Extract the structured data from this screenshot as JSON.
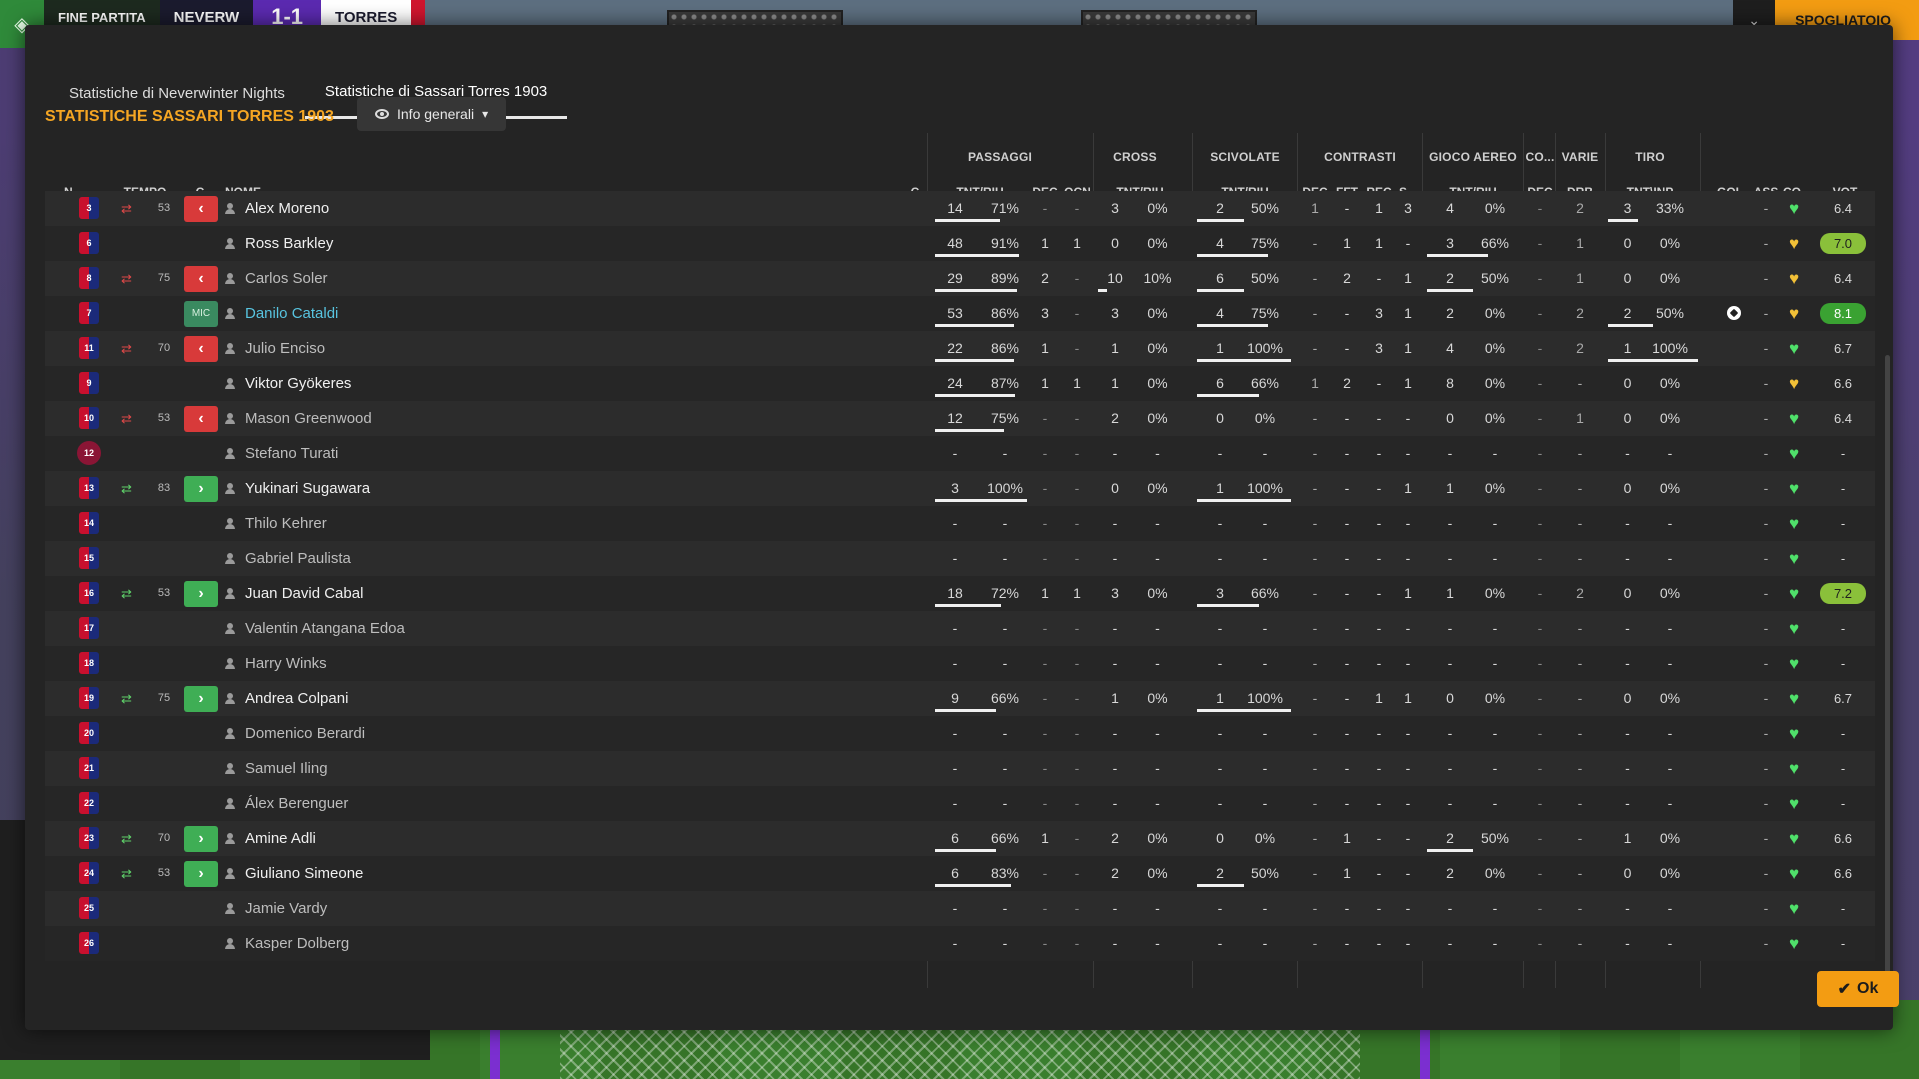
{
  "scorebar": {
    "status": "FINE PARTITA",
    "home": "NEVERW",
    "score": "1-1",
    "away": "TORRES"
  },
  "topright": {
    "collapse_icon": "chevron-down-icon",
    "dressing_room": "SPOGLIATOIO"
  },
  "tabs": [
    {
      "label": "Statistiche di Neverwinter Nights",
      "active": false
    },
    {
      "label": "Statistiche di Sassari Torres 1903",
      "active": true
    }
  ],
  "section_title": "STATISTICHE SASSARI TORRES 1903",
  "view_select": {
    "label": "Info generali"
  },
  "groups": {
    "passaggi": "PASSAGGI",
    "cross": "CROSS",
    "scivolate": "SCIVOLATE",
    "contrasti": "CONTRASTI",
    "gioco_aereo": "GIOCO AEREO",
    "co": "CO...",
    "varie": "VARIE",
    "tiro": "TIRO"
  },
  "headers": {
    "n": "N.",
    "tempo": "TEMPO",
    "c": "C",
    "nome": "NOME",
    "c2": "C",
    "pass_tnt": "TNT/RIU",
    "pass_dec": "DEC",
    "pass_ocn": "OCN",
    "cross_tnt": "TNT/RIU",
    "sciv_tnt": "TNT/RIU",
    "con_dec": "DEC",
    "con_fft": "FFT",
    "con_rec": "REC",
    "con_s": "S...",
    "aereo_tnt": "TNT/RIU",
    "co_dec": "DEC",
    "varie_drb": "DRB",
    "tiro_tnt": "TNT\\INP",
    "gol": "GOL",
    "ass": "ASS",
    "co2": "CO...",
    "vot": "VOT"
  },
  "players": [
    {
      "n": "3",
      "sub": "out",
      "min": "53",
      "c": "out",
      "name": "Alex Moreno",
      "played": true,
      "pass": [
        "14",
        "71%"
      ],
      "pass_bar": 0.71,
      "dec": "-",
      "ocn": "-",
      "cross": [
        "3",
        "0%"
      ],
      "cross_bar": 0,
      "sciv": [
        "2",
        "50%"
      ],
      "sciv_bar": 0.5,
      "con": [
        "1",
        "-",
        "1",
        "3"
      ],
      "aereo": [
        "4",
        "0%"
      ],
      "aereo_bar": 0,
      "codec": "-",
      "drb": "2",
      "tiro": [
        "3",
        "33%"
      ],
      "tiro_bar": 0.33,
      "gol": "",
      "ass": "-",
      "heart": "green",
      "vot": "6.4",
      "vclass": ""
    },
    {
      "n": "6",
      "sub": "",
      "min": "",
      "c": "",
      "name": "Ross Barkley",
      "played": true,
      "pass": [
        "48",
        "91%"
      ],
      "pass_bar": 0.91,
      "dec": "1",
      "ocn": "1",
      "cross": [
        "0",
        "0%"
      ],
      "cross_bar": 0,
      "sciv": [
        "4",
        "75%"
      ],
      "sciv_bar": 0.75,
      "con": [
        "-",
        "1",
        "1",
        "-"
      ],
      "aereo": [
        "3",
        "66%"
      ],
      "aereo_bar": 0.66,
      "codec": "-",
      "drb": "1",
      "tiro": [
        "0",
        "0%"
      ],
      "tiro_bar": 0,
      "gol": "",
      "ass": "-",
      "heart": "yellow",
      "vot": "7.0",
      "vclass": "mid"
    },
    {
      "n": "8",
      "sub": "out",
      "min": "75",
      "c": "out",
      "name": "Carlos Soler",
      "played": false,
      "pass": [
        "29",
        "89%"
      ],
      "pass_bar": 0.89,
      "dec": "2",
      "ocn": "-",
      "cross": [
        "10",
        "10%"
      ],
      "cross_bar": 0.1,
      "sciv": [
        "6",
        "50%"
      ],
      "sciv_bar": 0.5,
      "con": [
        "-",
        "2",
        "-",
        "1"
      ],
      "aereo": [
        "2",
        "50%"
      ],
      "aereo_bar": 0.5,
      "codec": "-",
      "drb": "1",
      "tiro": [
        "0",
        "0%"
      ],
      "tiro_bar": 0,
      "gol": "",
      "ass": "-",
      "heart": "yellow",
      "vot": "6.4",
      "vclass": ""
    },
    {
      "n": "7",
      "sub": "",
      "min": "",
      "c": "pos",
      "cpos": "MIC",
      "name": "Danilo Cataldi",
      "played": true,
      "highlight": true,
      "pass": [
        "53",
        "86%"
      ],
      "pass_bar": 0.86,
      "dec": "3",
      "ocn": "-",
      "cross": [
        "3",
        "0%"
      ],
      "cross_bar": 0,
      "sciv": [
        "4",
        "75%"
      ],
      "sciv_bar": 0.75,
      "con": [
        "-",
        "-",
        "3",
        "1"
      ],
      "aereo": [
        "2",
        "0%"
      ],
      "aereo_bar": 0,
      "codec": "-",
      "drb": "2",
      "tiro": [
        "2",
        "50%"
      ],
      "tiro_bar": 0.5,
      "gol": "ball",
      "ass": "-",
      "heart": "yellow",
      "vot": "8.1",
      "vclass": "good"
    },
    {
      "n": "11",
      "sub": "out",
      "min": "70",
      "c": "out",
      "name": "Julio Enciso",
      "played": false,
      "pass": [
        "22",
        "86%"
      ],
      "pass_bar": 0.86,
      "dec": "1",
      "ocn": "-",
      "cross": [
        "1",
        "0%"
      ],
      "cross_bar": 0,
      "sciv": [
        "1",
        "100%"
      ],
      "sciv_bar": 1,
      "con": [
        "-",
        "-",
        "3",
        "1"
      ],
      "aereo": [
        "4",
        "0%"
      ],
      "aereo_bar": 0,
      "codec": "-",
      "drb": "2",
      "tiro": [
        "1",
        "100%"
      ],
      "tiro_bar": 1,
      "gol": "",
      "ass": "-",
      "heart": "green",
      "vot": "6.7",
      "vclass": ""
    },
    {
      "n": "9",
      "sub": "",
      "min": "",
      "c": "",
      "name": "Viktor Gyökeres",
      "played": true,
      "pass": [
        "24",
        "87%"
      ],
      "pass_bar": 0.87,
      "dec": "1",
      "ocn": "1",
      "cross": [
        "1",
        "0%"
      ],
      "cross_bar": 0,
      "sciv": [
        "6",
        "66%"
      ],
      "sciv_bar": 0.66,
      "con": [
        "1",
        "2",
        "-",
        "1"
      ],
      "aereo": [
        "8",
        "0%"
      ],
      "aereo_bar": 0,
      "codec": "-",
      "drb": "-",
      "tiro": [
        "0",
        "0%"
      ],
      "tiro_bar": 0,
      "gol": "",
      "ass": "-",
      "heart": "yellow",
      "vot": "6.6",
      "vclass": ""
    },
    {
      "n": "10",
      "sub": "out",
      "min": "53",
      "c": "out",
      "name": "Mason Greenwood",
      "played": false,
      "pass": [
        "12",
        "75%"
      ],
      "pass_bar": 0.75,
      "dec": "-",
      "ocn": "-",
      "cross": [
        "2",
        "0%"
      ],
      "cross_bar": 0,
      "sciv": [
        "0",
        "0%"
      ],
      "sciv_bar": 0,
      "con": [
        "-",
        "-",
        "-",
        "-"
      ],
      "aereo": [
        "0",
        "0%"
      ],
      "aereo_bar": 0,
      "codec": "-",
      "drb": "1",
      "tiro": [
        "0",
        "0%"
      ],
      "tiro_bar": 0,
      "gol": "",
      "ass": "-",
      "heart": "green",
      "vot": "6.4",
      "vclass": ""
    },
    {
      "n": "12",
      "gk": true,
      "sub": "",
      "min": "",
      "c": "",
      "name": "Stefano Turati",
      "played": false,
      "pass": [
        "-",
        "-"
      ],
      "pass_bar": 0,
      "dec": "-",
      "ocn": "-",
      "cross": [
        "-",
        "-"
      ],
      "cross_bar": 0,
      "sciv": [
        "-",
        "-"
      ],
      "sciv_bar": 0,
      "con": [
        "-",
        "-",
        "-",
        "-"
      ],
      "aereo": [
        "-",
        "-"
      ],
      "aereo_bar": 0,
      "codec": "-",
      "drb": "-",
      "tiro": [
        "-",
        "-"
      ],
      "tiro_bar": 0,
      "gol": "",
      "ass": "-",
      "heart": "green",
      "vot": "-",
      "vclass": ""
    },
    {
      "n": "13",
      "sub": "in",
      "min": "83",
      "c": "in",
      "name": "Yukinari Sugawara",
      "played": true,
      "pass": [
        "3",
        "100%"
      ],
      "pass_bar": 1,
      "dec": "-",
      "ocn": "-",
      "cross": [
        "0",
        "0%"
      ],
      "cross_bar": 0,
      "sciv": [
        "1",
        "100%"
      ],
      "sciv_bar": 1,
      "con": [
        "-",
        "-",
        "-",
        "1"
      ],
      "aereo": [
        "1",
        "0%"
      ],
      "aereo_bar": 0,
      "codec": "-",
      "drb": "-",
      "tiro": [
        "0",
        "0%"
      ],
      "tiro_bar": 0,
      "gol": "",
      "ass": "-",
      "heart": "green",
      "vot": "-",
      "vclass": ""
    },
    {
      "n": "14",
      "sub": "",
      "min": "",
      "c": "",
      "name": "Thilo Kehrer",
      "played": false,
      "pass": [
        "-",
        "-"
      ],
      "pass_bar": 0,
      "dec": "-",
      "ocn": "-",
      "cross": [
        "-",
        "-"
      ],
      "cross_bar": 0,
      "sciv": [
        "-",
        "-"
      ],
      "sciv_bar": 0,
      "con": [
        "-",
        "-",
        "-",
        "-"
      ],
      "aereo": [
        "-",
        "-"
      ],
      "aereo_bar": 0,
      "codec": "-",
      "drb": "-",
      "tiro": [
        "-",
        "-"
      ],
      "tiro_bar": 0,
      "gol": "",
      "ass": "-",
      "heart": "green",
      "vot": "-",
      "vclass": ""
    },
    {
      "n": "15",
      "sub": "",
      "min": "",
      "c": "",
      "name": "Gabriel Paulista",
      "played": false,
      "pass": [
        "-",
        "-"
      ],
      "pass_bar": 0,
      "dec": "-",
      "ocn": "-",
      "cross": [
        "-",
        "-"
      ],
      "cross_bar": 0,
      "sciv": [
        "-",
        "-"
      ],
      "sciv_bar": 0,
      "con": [
        "-",
        "-",
        "-",
        "-"
      ],
      "aereo": [
        "-",
        "-"
      ],
      "aereo_bar": 0,
      "codec": "-",
      "drb": "-",
      "tiro": [
        "-",
        "-"
      ],
      "tiro_bar": 0,
      "gol": "",
      "ass": "-",
      "heart": "green",
      "vot": "-",
      "vclass": ""
    },
    {
      "n": "16",
      "sub": "in",
      "min": "53",
      "c": "in",
      "name": "Juan David Cabal",
      "played": true,
      "pass": [
        "18",
        "72%"
      ],
      "pass_bar": 0.72,
      "dec": "1",
      "ocn": "1",
      "cross": [
        "3",
        "0%"
      ],
      "cross_bar": 0,
      "sciv": [
        "3",
        "66%"
      ],
      "sciv_bar": 0.66,
      "con": [
        "-",
        "-",
        "-",
        "1"
      ],
      "aereo": [
        "1",
        "0%"
      ],
      "aereo_bar": 0,
      "codec": "-",
      "drb": "2",
      "tiro": [
        "0",
        "0%"
      ],
      "tiro_bar": 0,
      "gol": "",
      "ass": "-",
      "heart": "green",
      "vot": "7.2",
      "vclass": "mid"
    },
    {
      "n": "17",
      "sub": "",
      "min": "",
      "c": "",
      "name": "Valentin Atangana Edoa",
      "played": false,
      "pass": [
        "-",
        "-"
      ],
      "pass_bar": 0,
      "dec": "-",
      "ocn": "-",
      "cross": [
        "-",
        "-"
      ],
      "cross_bar": 0,
      "sciv": [
        "-",
        "-"
      ],
      "sciv_bar": 0,
      "con": [
        "-",
        "-",
        "-",
        "-"
      ],
      "aereo": [
        "-",
        "-"
      ],
      "aereo_bar": 0,
      "codec": "-",
      "drb": "-",
      "tiro": [
        "-",
        "-"
      ],
      "tiro_bar": 0,
      "gol": "",
      "ass": "-",
      "heart": "green",
      "vot": "-",
      "vclass": ""
    },
    {
      "n": "18",
      "sub": "",
      "min": "",
      "c": "",
      "name": "Harry Winks",
      "played": false,
      "pass": [
        "-",
        "-"
      ],
      "pass_bar": 0,
      "dec": "-",
      "ocn": "-",
      "cross": [
        "-",
        "-"
      ],
      "cross_bar": 0,
      "sciv": [
        "-",
        "-"
      ],
      "sciv_bar": 0,
      "con": [
        "-",
        "-",
        "-",
        "-"
      ],
      "aereo": [
        "-",
        "-"
      ],
      "aereo_bar": 0,
      "codec": "-",
      "drb": "-",
      "tiro": [
        "-",
        "-"
      ],
      "tiro_bar": 0,
      "gol": "",
      "ass": "-",
      "heart": "green",
      "vot": "-",
      "vclass": ""
    },
    {
      "n": "19",
      "sub": "in",
      "min": "75",
      "c": "in",
      "name": "Andrea Colpani",
      "played": true,
      "pass": [
        "9",
        "66%"
      ],
      "pass_bar": 0.66,
      "dec": "-",
      "ocn": "-",
      "cross": [
        "1",
        "0%"
      ],
      "cross_bar": 0,
      "sciv": [
        "1",
        "100%"
      ],
      "sciv_bar": 1,
      "con": [
        "-",
        "-",
        "1",
        "1"
      ],
      "aereo": [
        "0",
        "0%"
      ],
      "aereo_bar": 0,
      "codec": "-",
      "drb": "-",
      "tiro": [
        "0",
        "0%"
      ],
      "tiro_bar": 0,
      "gol": "",
      "ass": "-",
      "heart": "green",
      "vot": "6.7",
      "vclass": ""
    },
    {
      "n": "20",
      "sub": "",
      "min": "",
      "c": "",
      "name": "Domenico Berardi",
      "played": false,
      "pass": [
        "-",
        "-"
      ],
      "pass_bar": 0,
      "dec": "-",
      "ocn": "-",
      "cross": [
        "-",
        "-"
      ],
      "cross_bar": 0,
      "sciv": [
        "-",
        "-"
      ],
      "sciv_bar": 0,
      "con": [
        "-",
        "-",
        "-",
        "-"
      ],
      "aereo": [
        "-",
        "-"
      ],
      "aereo_bar": 0,
      "codec": "-",
      "drb": "-",
      "tiro": [
        "-",
        "-"
      ],
      "tiro_bar": 0,
      "gol": "",
      "ass": "-",
      "heart": "green",
      "vot": "-",
      "vclass": ""
    },
    {
      "n": "21",
      "sub": "",
      "min": "",
      "c": "",
      "name": "Samuel Iling",
      "played": false,
      "pass": [
        "-",
        "-"
      ],
      "pass_bar": 0,
      "dec": "-",
      "ocn": "-",
      "cross": [
        "-",
        "-"
      ],
      "cross_bar": 0,
      "sciv": [
        "-",
        "-"
      ],
      "sciv_bar": 0,
      "con": [
        "-",
        "-",
        "-",
        "-"
      ],
      "aereo": [
        "-",
        "-"
      ],
      "aereo_bar": 0,
      "codec": "-",
      "drb": "-",
      "tiro": [
        "-",
        "-"
      ],
      "tiro_bar": 0,
      "gol": "",
      "ass": "-",
      "heart": "green",
      "vot": "-",
      "vclass": ""
    },
    {
      "n": "22",
      "sub": "",
      "min": "",
      "c": "",
      "name": "Álex Berenguer",
      "played": false,
      "pass": [
        "-",
        "-"
      ],
      "pass_bar": 0,
      "dec": "-",
      "ocn": "-",
      "cross": [
        "-",
        "-"
      ],
      "cross_bar": 0,
      "sciv": [
        "-",
        "-"
      ],
      "sciv_bar": 0,
      "con": [
        "-",
        "-",
        "-",
        "-"
      ],
      "aereo": [
        "-",
        "-"
      ],
      "aereo_bar": 0,
      "codec": "-",
      "drb": "-",
      "tiro": [
        "-",
        "-"
      ],
      "tiro_bar": 0,
      "gol": "",
      "ass": "-",
      "heart": "green",
      "vot": "-",
      "vclass": ""
    },
    {
      "n": "23",
      "sub": "in",
      "min": "70",
      "c": "in",
      "name": "Amine Adli",
      "played": true,
      "pass": [
        "6",
        "66%"
      ],
      "pass_bar": 0.66,
      "dec": "1",
      "ocn": "-",
      "cross": [
        "2",
        "0%"
      ],
      "cross_bar": 0,
      "sciv": [
        "0",
        "0%"
      ],
      "sciv_bar": 0,
      "con": [
        "-",
        "1",
        "-",
        "-"
      ],
      "aereo": [
        "2",
        "50%"
      ],
      "aereo_bar": 0.5,
      "codec": "-",
      "drb": "-",
      "tiro": [
        "1",
        "0%"
      ],
      "tiro_bar": 0,
      "gol": "",
      "ass": "-",
      "heart": "green",
      "vot": "6.6",
      "vclass": ""
    },
    {
      "n": "24",
      "sub": "in",
      "min": "53",
      "c": "in",
      "name": "Giuliano Simeone",
      "played": true,
      "pass": [
        "6",
        "83%"
      ],
      "pass_bar": 0.83,
      "dec": "-",
      "ocn": "-",
      "cross": [
        "2",
        "0%"
      ],
      "cross_bar": 0,
      "sciv": [
        "2",
        "50%"
      ],
      "sciv_bar": 0.5,
      "con": [
        "-",
        "1",
        "-",
        "-"
      ],
      "aereo": [
        "2",
        "0%"
      ],
      "aereo_bar": 0,
      "codec": "-",
      "drb": "-",
      "tiro": [
        "0",
        "0%"
      ],
      "tiro_bar": 0,
      "gol": "",
      "ass": "-",
      "heart": "green",
      "vot": "6.6",
      "vclass": ""
    },
    {
      "n": "25",
      "sub": "",
      "min": "",
      "c": "",
      "name": "Jamie Vardy",
      "played": false,
      "pass": [
        "-",
        "-"
      ],
      "pass_bar": 0,
      "dec": "-",
      "ocn": "-",
      "cross": [
        "-",
        "-"
      ],
      "cross_bar": 0,
      "sciv": [
        "-",
        "-"
      ],
      "sciv_bar": 0,
      "con": [
        "-",
        "-",
        "-",
        "-"
      ],
      "aereo": [
        "-",
        "-"
      ],
      "aereo_bar": 0,
      "codec": "-",
      "drb": "-",
      "tiro": [
        "-",
        "-"
      ],
      "tiro_bar": 0,
      "gol": "",
      "ass": "-",
      "heart": "green",
      "vot": "-",
      "vclass": ""
    },
    {
      "n": "26",
      "sub": "",
      "min": "",
      "c": "",
      "name": "Kasper Dolberg",
      "played": false,
      "pass": [
        "-",
        "-"
      ],
      "pass_bar": 0,
      "dec": "-",
      "ocn": "-",
      "cross": [
        "-",
        "-"
      ],
      "cross_bar": 0,
      "sciv": [
        "-",
        "-"
      ],
      "sciv_bar": 0,
      "con": [
        "-",
        "-",
        "-",
        "-"
      ],
      "aereo": [
        "-",
        "-"
      ],
      "aereo_bar": 0,
      "codec": "-",
      "drb": "-",
      "tiro": [
        "-",
        "-"
      ],
      "tiro_bar": 0,
      "gol": "",
      "ass": "-",
      "heart": "green",
      "vot": "-",
      "vclass": ""
    }
  ],
  "colors": {
    "accent": "#f5a623",
    "heart_green": "#4fe06a",
    "heart_yellow": "#f2c037",
    "out": "#d83a3a",
    "in": "#3fae55"
  },
  "ok_button": {
    "label": "Ok"
  }
}
